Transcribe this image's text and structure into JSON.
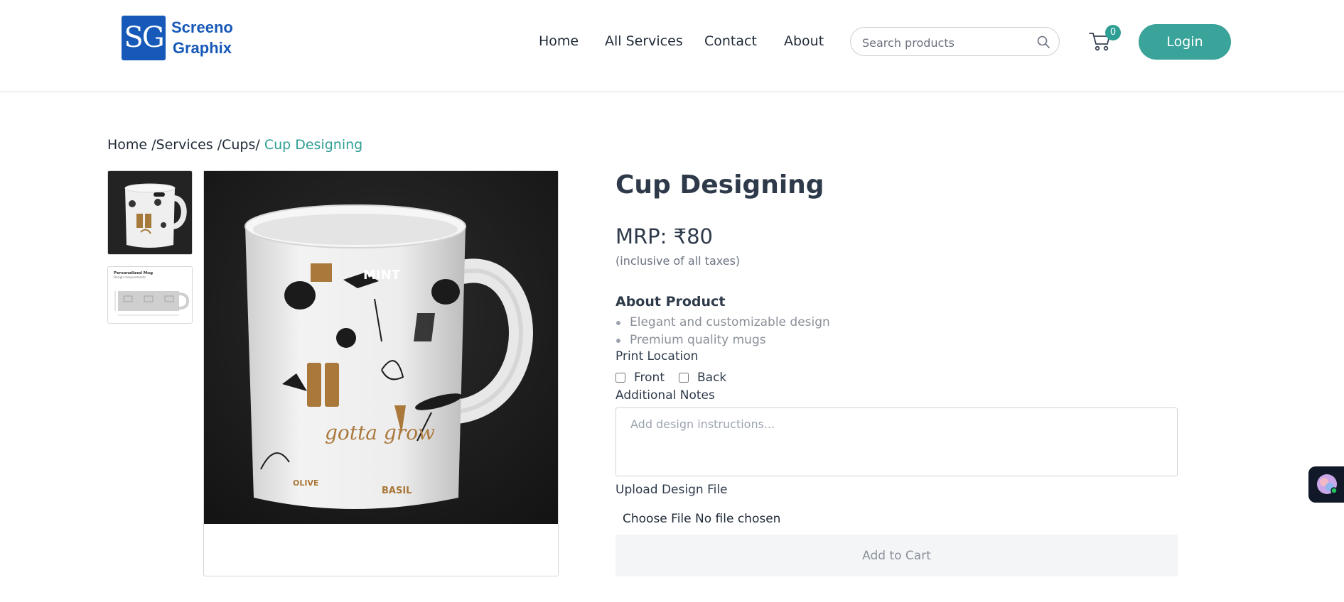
{
  "header": {
    "logo": {
      "mark": "SG",
      "line1": "Screeno",
      "line2": "Graphix"
    },
    "nav": [
      "Home",
      "All Services",
      "Contact",
      "About"
    ],
    "search": {
      "placeholder": "Search products",
      "value": ""
    },
    "cart_count": "0",
    "login_label": "Login"
  },
  "breadcrumb": {
    "trail": "Home /Services /Cups/",
    "current": "Cup Designing"
  },
  "product": {
    "title": "Cup Designing",
    "price": "MRP: ₹80",
    "tax_note": "(inclusive of all taxes)",
    "about_heading": "About Product",
    "features": [
      "Elegant and customizable design",
      "Premium quality mugs"
    ],
    "print_location_label": "Print Location",
    "print_options": [
      "Front",
      "Back"
    ],
    "notes_label": "Additional Notes",
    "notes_placeholder": "Add design instructions...",
    "upload_label": "Upload Design File",
    "file_status": "Choose File No file chosen",
    "add_to_cart": "Add to Cart"
  },
  "thumbnail_2": {
    "title": "Personalized Mug",
    "subtitle": "Design measurements"
  },
  "mug_print": [
    "MINT",
    "gotta grow",
    "OLIVE",
    "BASIL"
  ],
  "colors": {
    "accent": "#3aa39a",
    "brand": "#1659b8",
    "text": "#2e3a4a"
  }
}
